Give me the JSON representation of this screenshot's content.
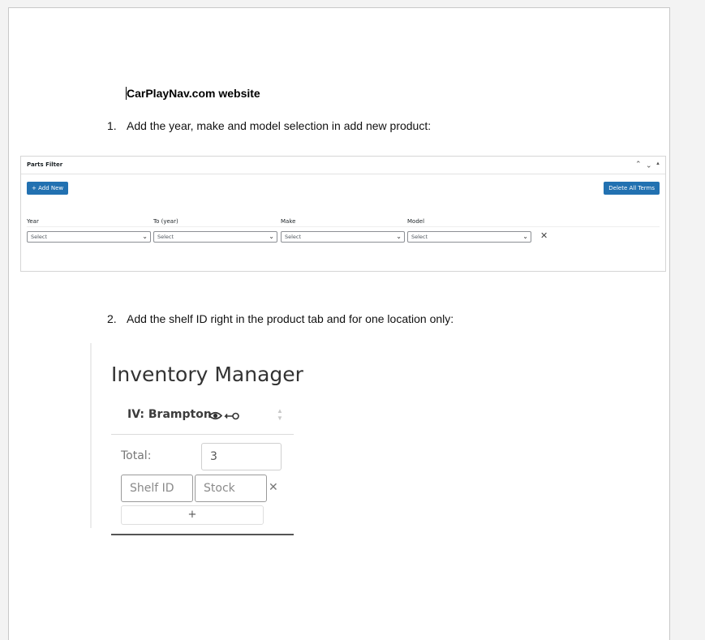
{
  "document": {
    "title": "CarPlayNav.com website",
    "steps": [
      {
        "number": "1.",
        "text": "Add the year, make and model selection in add new product:"
      },
      {
        "number": "2.",
        "text": "Add the shelf ID right in the product tab and for one location only:"
      }
    ]
  },
  "parts_filter": {
    "title": "Parts Filter",
    "add_new_label": "+ Add New",
    "delete_all_label": "Delete All Terms",
    "columns": [
      "Year",
      "To (year)",
      "Make",
      "Model"
    ],
    "select_value": "Select",
    "remove_glyph": "✕"
  },
  "inventory_manager": {
    "title": "Inventory Manager",
    "location": "IV: Brampton",
    "total_label": "Total:",
    "total_value": "3",
    "shelf_placeholder": "Shelf ID",
    "stock_placeholder": "Stock",
    "remove_glyph": "✕",
    "add_glyph": "+"
  },
  "icons": [
    "eye-icon",
    "key-icon",
    "sort-arrows-icon",
    "chevron-up-icon",
    "chevron-down-icon",
    "triangle-up-icon",
    "close-icon"
  ]
}
